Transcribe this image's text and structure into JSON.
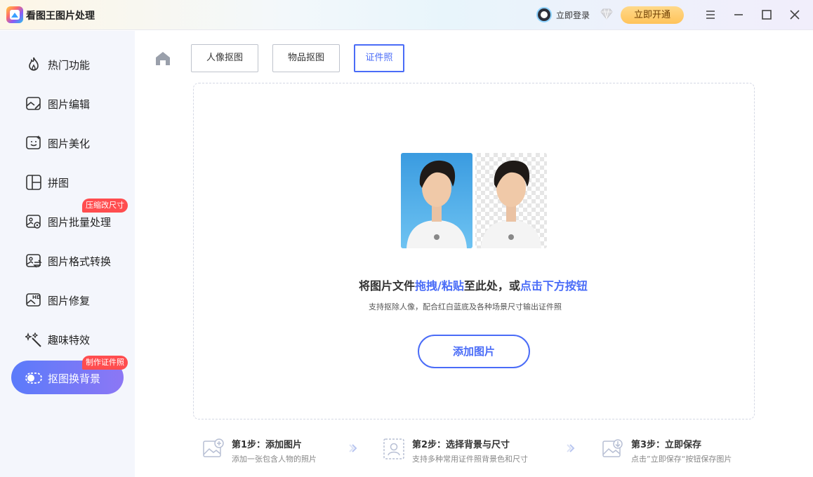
{
  "app": {
    "title": "看图王图片处理"
  },
  "header": {
    "login_label": "立即登录",
    "vip_button_label": "立即开通",
    "window_icons": [
      "menu-icon",
      "minimize-icon",
      "maximize-icon",
      "close-icon"
    ]
  },
  "sidebar": {
    "items": [
      {
        "label": "热门功能",
        "icon": "flame-icon"
      },
      {
        "label": "图片编辑",
        "icon": "image-edit-icon"
      },
      {
        "label": "图片美化",
        "icon": "image-beautify-icon"
      },
      {
        "label": "拼图",
        "icon": "collage-icon"
      },
      {
        "label": "图片批量处理",
        "icon": "image-batch-icon",
        "badge": "压缩改尺寸"
      },
      {
        "label": "图片格式转换",
        "icon": "image-convert-icon"
      },
      {
        "label": "图片修复",
        "icon": "image-hd-icon"
      },
      {
        "label": "趣味特效",
        "icon": "magic-wand-icon"
      },
      {
        "label": "抠图换背景",
        "icon": "toggle-icon",
        "badge": "制作证件照",
        "active": true
      }
    ]
  },
  "tabs": [
    {
      "label": "人像抠图",
      "active": false
    },
    {
      "label": "物品抠图",
      "active": false
    },
    {
      "label": "证件照",
      "active": true
    }
  ],
  "dropzone": {
    "headline_part1": "将图片文件",
    "headline_highlight1": "拖拽/粘贴",
    "headline_part2": "至此处，或",
    "headline_highlight2": "点击下方按钮",
    "subtext": "支持抠除人像，配合红白蓝底及各种场景尺寸输出证件照",
    "add_button_label": "添加图片"
  },
  "steps": [
    {
      "title": "第1步：添加图片",
      "desc": "添加一张包含人物的照片",
      "icon": "add-image-icon"
    },
    {
      "title": "第2步：选择背景与尺寸",
      "desc": "支持多种常用证件照背景色和尺寸",
      "icon": "portrait-icon"
    },
    {
      "title": "第3步：立即保存",
      "desc": "点击”立即保存“按钮保存图片",
      "icon": "save-image-icon"
    }
  ],
  "colors": {
    "accent": "#4a6cf7",
    "badge": "#ff4d4f",
    "sidebar_bg": "#f4f6fc"
  }
}
